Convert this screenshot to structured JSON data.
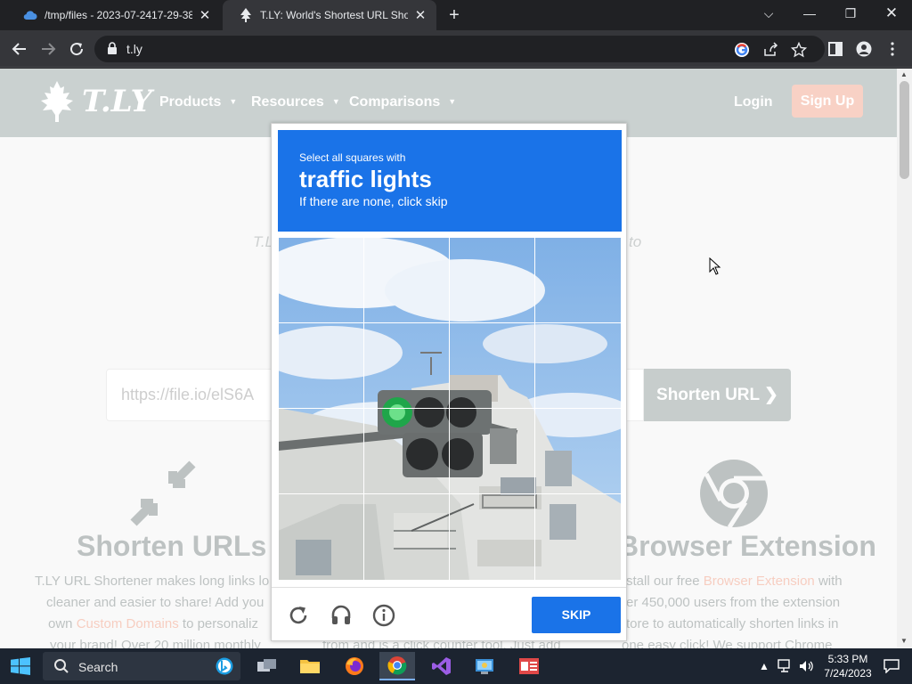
{
  "browser": {
    "tabs": [
      {
        "title": "/tmp/files - 2023-07-2417-29-38",
        "active": false
      },
      {
        "title": "T.LY: World's Shortest URL Shortener",
        "active": true
      }
    ],
    "url": "t.ly",
    "window_controls": [
      "chevron-down",
      "minimize",
      "restore",
      "close"
    ]
  },
  "site": {
    "logo_text": "T.LY",
    "nav": [
      {
        "label": "Products"
      },
      {
        "label": "Resources"
      },
      {
        "label": "Comparisons"
      }
    ],
    "login_label": "Login",
    "signup_label": "Sign Up",
    "tagline_left": "T.L",
    "tagline_right": "to",
    "url_placeholder": "https://file.io/elS6A",
    "shorten_label": "Shorten URL",
    "features": [
      {
        "title": "Shorten URLs",
        "icon": "compress-arrows-icon",
        "lines": [
          {
            "pre": "T.LY URL Shortener makes long links lo",
            "link": "",
            "post": ""
          },
          {
            "pre": "cleaner and easier to share! Add you",
            "link": "",
            "post": ""
          },
          {
            "pre": "own ",
            "link": "Custom Domains",
            "post": " to personaliz"
          },
          {
            "pre": "your brand! Over 20 million monthly",
            "link": "",
            "post": ""
          }
        ]
      },
      {
        "title": "",
        "icon": "",
        "lines": [
          {
            "pre": "from and is a click counter tool. Just add",
            "link": "",
            "post": ""
          }
        ]
      },
      {
        "title": "Browser Extension",
        "icon": "chrome-icon",
        "lines": [
          {
            "pre": "stall our free ",
            "link": "Browser Extension",
            "post": " with"
          },
          {
            "pre": "er 450,000 users from the extension",
            "link": "",
            "post": ""
          },
          {
            "pre": "tore to automatically shorten links in",
            "link": "",
            "post": ""
          },
          {
            "pre": "one easy click! We support Chrome",
            "link": "",
            "post": ""
          }
        ]
      }
    ],
    "colors": {
      "header": "#95a3a0",
      "signup": "#f0a38b",
      "link": "#ee9a80",
      "button": "#8f9b99"
    }
  },
  "captcha": {
    "instruction": "Select all squares with",
    "target": "traffic lights",
    "hint": "If there are none, click skip",
    "skip_label": "SKIP",
    "grid_size": 4,
    "accent": "#1a73e8"
  },
  "taskbar": {
    "search_label": "Search",
    "apps": [
      "bing-icon",
      "file-explorer-task-icon",
      "folder-icon",
      "firefox-icon",
      "chrome-icon",
      "visual-studio-icon",
      "control-panel-icon",
      "news-icon"
    ],
    "time": "5:33 PM",
    "date": "7/24/2023"
  }
}
